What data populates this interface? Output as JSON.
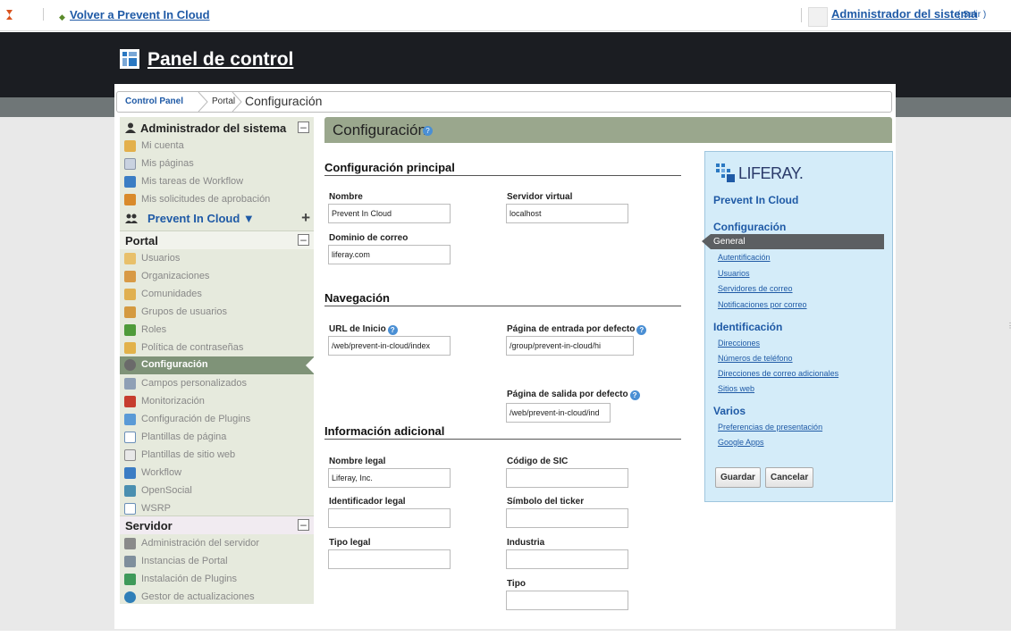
{
  "dockbar": {
    "back_label": "Volver a Prevent In Cloud",
    "user_name": "Administrador del sistema",
    "logout_label": "( Salir )"
  },
  "header": {
    "title": "Panel de control"
  },
  "breadcrumb": {
    "items": [
      "Control Panel",
      "Portal"
    ],
    "current": "Configuración"
  },
  "sidebar": {
    "user_section": {
      "title": "Administrador del sistema",
      "items": [
        "Mi cuenta",
        "Mis páginas",
        "Mis tareas de Workflow",
        "Mis solicitudes de aprobación"
      ]
    },
    "site_selector": {
      "label": "Prevent In Cloud ▼"
    },
    "portal_section": {
      "title": "Portal",
      "items": [
        "Usuarios",
        "Organizaciones",
        "Comunidades",
        "Grupos de usuarios",
        "Roles",
        "Política de contraseñas",
        "Configuración",
        "Campos personalizados",
        "Monitorización",
        "Configuración de Plugins",
        "Plantillas de página",
        "Plantillas de sitio web",
        "Workflow",
        "OpenSocial",
        "WSRP"
      ]
    },
    "server_section": {
      "title": "Servidor",
      "items": [
        "Administración del servidor",
        "Instancias de Portal",
        "Instalación de Plugins",
        "Gestor de actualizaciones"
      ]
    }
  },
  "main": {
    "title": "Configuración",
    "sections": {
      "principal": "Configuración principal",
      "navegacion": "Navegación",
      "adicional": "Información adicional"
    },
    "fields": {
      "nombre": {
        "label": "Nombre",
        "value": "Prevent In Cloud"
      },
      "servidor_virtual": {
        "label": "Servidor virtual",
        "value": "localhost"
      },
      "dominio_correo": {
        "label": "Dominio de correo",
        "value": "liferay.com"
      },
      "url_inicio": {
        "label": "URL de Inicio",
        "value": "/web/prevent-in-cloud/index"
      },
      "pagina_entrada": {
        "label": "Página de entrada por defecto",
        "value": "/group/prevent-in-cloud/hi"
      },
      "pagina_salida": {
        "label": "Página de salida por defecto",
        "value": "/web/prevent-in-cloud/ind"
      },
      "nombre_legal": {
        "label": "Nombre legal",
        "value": "Liferay, Inc."
      },
      "codigo_sic": {
        "label": "Código de SIC",
        "value": ""
      },
      "identificador_legal": {
        "label": "Identificador legal",
        "value": ""
      },
      "simbolo_ticker": {
        "label": "Símbolo del ticker",
        "value": ""
      },
      "tipo_legal": {
        "label": "Tipo legal",
        "value": ""
      },
      "industria": {
        "label": "Industria",
        "value": ""
      },
      "tipo": {
        "label": "Tipo",
        "value": ""
      }
    }
  },
  "rightnav": {
    "logo_text": "LIFERAY.",
    "portal_name": "Prevent In Cloud",
    "configuracion": {
      "title": "Configuración",
      "active": "General",
      "links": [
        "Autentificación",
        "Usuarios",
        "Servidores de correo",
        "Notificaciones por correo"
      ]
    },
    "identificacion": {
      "title": "Identificación",
      "links": [
        "Direcciones",
        "Números de teléfono",
        "Direcciones de correo adicionales",
        "Sitios web"
      ]
    },
    "varios": {
      "title": "Varios",
      "links": [
        "Preferencias de presentación",
        "Google Apps"
      ]
    },
    "save_label": "Guardar",
    "cancel_label": "Cancelar"
  },
  "colors": {
    "header_bg": "#1b1d22",
    "sidebar_bg": "#e6eadd",
    "active_item": "#7f9378",
    "title_bar": "#9aa78d",
    "rightnav_bg": "#d4ecf9",
    "link": "#1f5aa6"
  }
}
